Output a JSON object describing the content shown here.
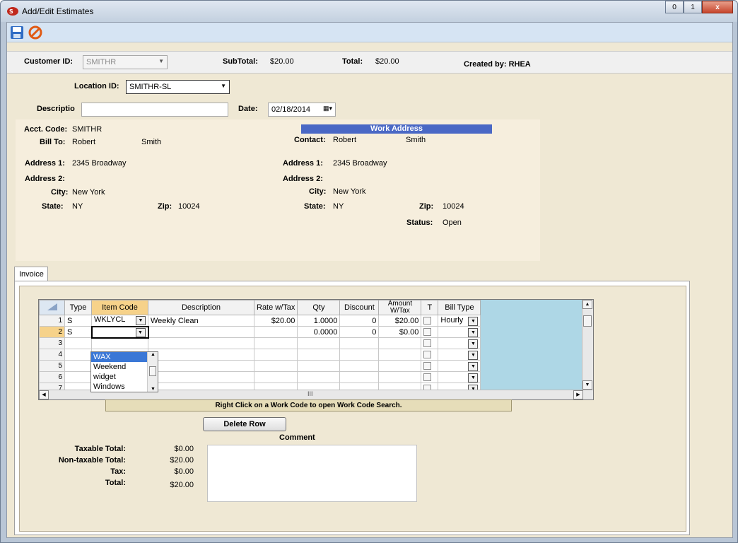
{
  "window": {
    "title": "Add/Edit Estimates",
    "minimize": "0",
    "maximize": "1",
    "close": "x"
  },
  "header": {
    "customer_id_label": "Customer ID:",
    "customer_id_value": "SMITHR",
    "subtotal_label": "SubTotal:",
    "subtotal_value": "$20.00",
    "total_label": "Total:",
    "total_value": "$20.00",
    "created_by": "Created by: RHEA"
  },
  "form": {
    "location_label": "Location ID:",
    "location_value": "SMITHR-SL",
    "description_label": "Descriptio",
    "description_value": "",
    "date_label": "Date:",
    "date_value": "02/18/2014"
  },
  "bill": {
    "acct_code_label": "Acct. Code:",
    "acct_code": "SMITHR",
    "bill_to_label": "Bill To:",
    "first_name": "Robert",
    "last_name": "Smith",
    "address1_label": "Address 1:",
    "address1": "2345 Broadway",
    "address2_label": "Address 2:",
    "city_label": "City:",
    "city": "New York",
    "state_label": "State:",
    "state": "NY",
    "zip_label": "Zip:",
    "zip": "10024"
  },
  "work": {
    "header": "Work Address",
    "contact_label": "Contact:",
    "first_name": "Robert",
    "last_name": "Smith",
    "address1_label": "Address 1:",
    "address1": "2345 Broadway",
    "address2_label": "Address 2:",
    "city_label": "City:",
    "city": "New York",
    "state_label": "State:",
    "state": "NY",
    "zip_label": "Zip:",
    "zip": "10024",
    "status_label": "Status:",
    "status": "Open"
  },
  "tabs": {
    "invoice": "Invoice"
  },
  "grid": {
    "columns": [
      "Type",
      "Item Code",
      "Description",
      "Rate w/Tax",
      "Qty",
      "Discount",
      "Amount W/Tax",
      "T",
      "Bill Type"
    ],
    "rows": [
      {
        "num": "1",
        "type": "S",
        "item": "WKLYCL",
        "desc": "Weekly Clean",
        "rate": "$20.00",
        "qty": "1.0000",
        "discount": "0",
        "amount": "$20.00",
        "bill_type": "Hourly"
      },
      {
        "num": "2",
        "type": "S",
        "item": "",
        "desc": "",
        "rate": "",
        "qty": "0.0000",
        "discount": "0",
        "amount": "$0.00",
        "bill_type": ""
      },
      {
        "num": "3",
        "type": "",
        "item": "",
        "desc": "",
        "rate": "",
        "qty": "",
        "discount": "",
        "amount": "",
        "bill_type": ""
      },
      {
        "num": "4",
        "type": "",
        "item": "",
        "desc": "",
        "rate": "",
        "qty": "",
        "discount": "",
        "amount": "",
        "bill_type": ""
      },
      {
        "num": "5",
        "type": "",
        "item": "",
        "desc": "",
        "rate": "",
        "qty": "",
        "discount": "",
        "amount": "",
        "bill_type": ""
      },
      {
        "num": "6",
        "type": "",
        "item": "",
        "desc": "",
        "rate": "",
        "qty": "",
        "discount": "",
        "amount": "",
        "bill_type": ""
      },
      {
        "num": "7",
        "type": "",
        "item": "",
        "desc": "",
        "rate": "",
        "qty": "",
        "discount": "",
        "amount": "",
        "bill_type": ""
      }
    ],
    "dropdown_options": [
      "WAX",
      "Weekend",
      "widget",
      "Windows"
    ],
    "hscroll_grip": "III"
  },
  "hint": "Right Click on a Work Code to open Work Code Search.",
  "delete_row": "Delete Row",
  "comment_label": "Comment",
  "totals": {
    "taxable_label": "Taxable Total:",
    "taxable": "$0.00",
    "nontaxable_label": "Non-taxable Total:",
    "nontaxable": "$20.00",
    "tax_label": "Tax:",
    "tax": "$0.00",
    "total_label": "Total:",
    "total": "$20.00"
  },
  "colors": {
    "work_header": "#4a68c5",
    "selected_header": "#f6d28a",
    "grid_bg": "#aed7e6",
    "form_bg": "#efe8d4"
  }
}
